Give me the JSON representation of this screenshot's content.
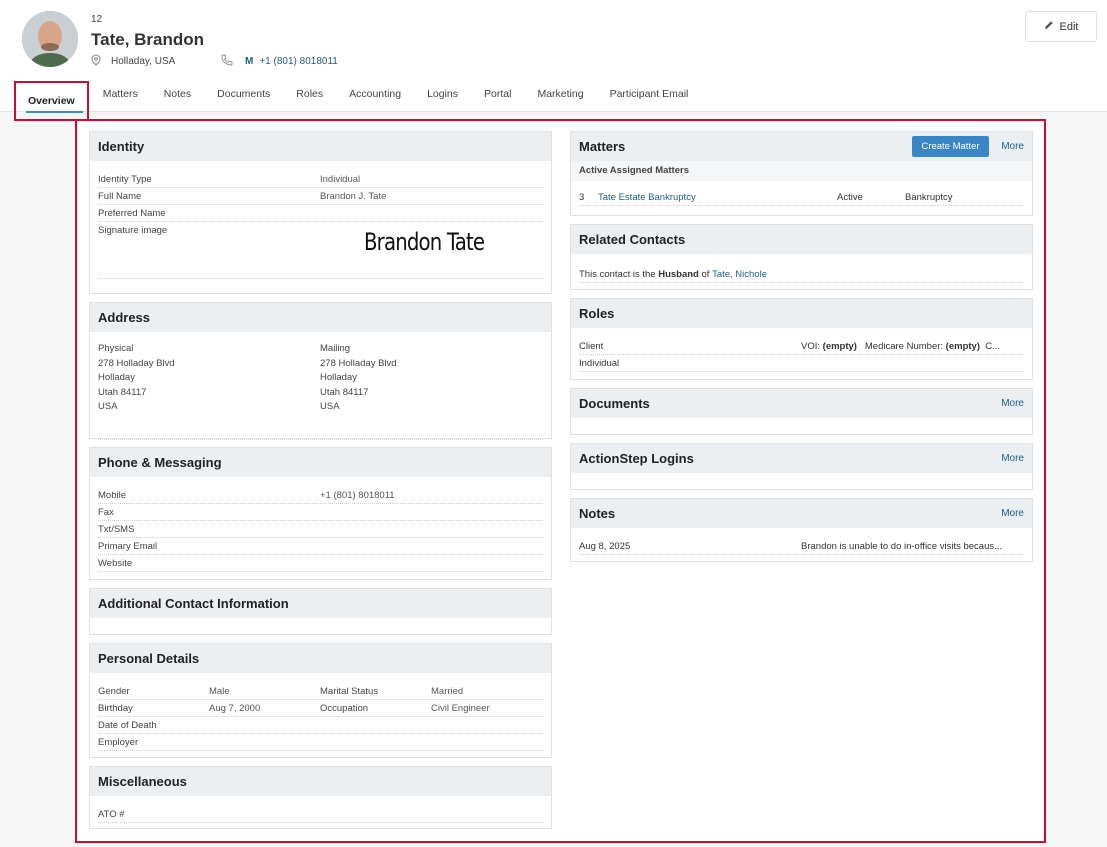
{
  "contact": {
    "id": "12",
    "name": "Tate, Brandon",
    "location": "Holladay, USA",
    "phone_label": "M",
    "phone": "+1 (801) 8018011"
  },
  "toolbar": {
    "edit_label": "Edit"
  },
  "tabs": [
    "Overview",
    "Matters",
    "Notes",
    "Documents",
    "Roles",
    "Accounting",
    "Logins",
    "Portal",
    "Marketing",
    "Participant Email"
  ],
  "identity": {
    "title": "Identity",
    "rows": [
      {
        "k": "Identity Type",
        "v": "Individual"
      },
      {
        "k": "Full Name",
        "v": "Brandon J. Tate"
      },
      {
        "k": "Preferred Name",
        "v": ""
      },
      {
        "k": "Signature image",
        "v": ""
      }
    ],
    "signature_text": "Brandon Tate"
  },
  "address": {
    "title": "Address",
    "physical": {
      "label": "Physical",
      "line1": "278 Holladay Blvd",
      "city": "Holladay",
      "state_zip": "Utah 84117",
      "country": "USA"
    },
    "mailing": {
      "label": "Mailing",
      "line1": "278 Holladay Blvd",
      "city": "Holladay",
      "state_zip": "Utah 84117",
      "country": "USA"
    }
  },
  "phone_messaging": {
    "title": "Phone & Messaging",
    "rows": [
      {
        "k": "Mobile",
        "v": "+1 (801) 8018011"
      },
      {
        "k": "Fax",
        "v": ""
      },
      {
        "k": "Txt/SMS",
        "v": ""
      },
      {
        "k": "Primary Email",
        "v": ""
      },
      {
        "k": "Website",
        "v": ""
      }
    ]
  },
  "additional": {
    "title": "Additional Contact Information"
  },
  "personal": {
    "title": "Personal Details",
    "rows": [
      {
        "c1": "Gender",
        "c2": "Male",
        "c3": "Marital Status",
        "c4": "Married"
      },
      {
        "c1": "Birthday",
        "c2": "Aug 7, 2000",
        "c3": "Occupation",
        "c4": "Civil Engineer"
      },
      {
        "c1": "Date of Death",
        "c2": "",
        "c3": "",
        "c4": ""
      },
      {
        "c1": "Employer",
        "c2": "",
        "c3": "",
        "c4": ""
      }
    ]
  },
  "misc": {
    "title": "Miscellaneous",
    "rows": [
      {
        "k": "ATO #",
        "v": ""
      }
    ]
  },
  "matters": {
    "title": "Matters",
    "create_label": "Create Matter",
    "more_label": "More",
    "subheading": "Active Assigned Matters",
    "items": [
      {
        "num": "3",
        "name": "Tate Estate Bankruptcy",
        "status": "Active",
        "type": "Bankruptcy"
      }
    ]
  },
  "related": {
    "title": "Related Contacts",
    "prefix": "This contact is the",
    "relation": "Husband",
    "of": "of",
    "person": "Tate, Nichole"
  },
  "roles": {
    "title": "Roles",
    "role": "Client",
    "sub": "Individual",
    "voi_label": "VOI:",
    "voi_value": "(empty)",
    "medicare_label": "Medicare Number:",
    "medicare_value": "(empty)",
    "trailing": "C..."
  },
  "documents": {
    "title": "Documents",
    "more_label": "More"
  },
  "logins": {
    "title": "ActionStep Logins",
    "more_label": "More"
  },
  "notes": {
    "title": "Notes",
    "more_label": "More",
    "items": [
      {
        "date": "Aug 8, 2025",
        "text": "Brandon is unable to do in-office visits becaus..."
      }
    ]
  }
}
